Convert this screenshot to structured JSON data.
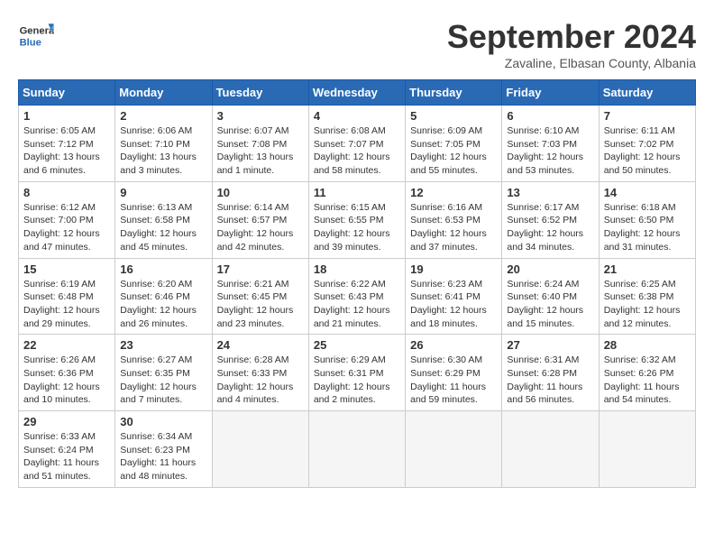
{
  "header": {
    "logo_text_general": "General",
    "logo_text_blue": "Blue",
    "month": "September 2024",
    "location": "Zavaline, Elbasan County, Albania"
  },
  "days_of_week": [
    "Sunday",
    "Monday",
    "Tuesday",
    "Wednesday",
    "Thursday",
    "Friday",
    "Saturday"
  ],
  "weeks": [
    [
      {
        "day": "1",
        "sunrise": "6:05 AM",
        "sunset": "7:12 PM",
        "daylight": "13 hours and 6 minutes."
      },
      {
        "day": "2",
        "sunrise": "6:06 AM",
        "sunset": "7:10 PM",
        "daylight": "13 hours and 3 minutes."
      },
      {
        "day": "3",
        "sunrise": "6:07 AM",
        "sunset": "7:08 PM",
        "daylight": "13 hours and 1 minute."
      },
      {
        "day": "4",
        "sunrise": "6:08 AM",
        "sunset": "7:07 PM",
        "daylight": "12 hours and 58 minutes."
      },
      {
        "day": "5",
        "sunrise": "6:09 AM",
        "sunset": "7:05 PM",
        "daylight": "12 hours and 55 minutes."
      },
      {
        "day": "6",
        "sunrise": "6:10 AM",
        "sunset": "7:03 PM",
        "daylight": "12 hours and 53 minutes."
      },
      {
        "day": "7",
        "sunrise": "6:11 AM",
        "sunset": "7:02 PM",
        "daylight": "12 hours and 50 minutes."
      }
    ],
    [
      {
        "day": "8",
        "sunrise": "6:12 AM",
        "sunset": "7:00 PM",
        "daylight": "12 hours and 47 minutes."
      },
      {
        "day": "9",
        "sunrise": "6:13 AM",
        "sunset": "6:58 PM",
        "daylight": "12 hours and 45 minutes."
      },
      {
        "day": "10",
        "sunrise": "6:14 AM",
        "sunset": "6:57 PM",
        "daylight": "12 hours and 42 minutes."
      },
      {
        "day": "11",
        "sunrise": "6:15 AM",
        "sunset": "6:55 PM",
        "daylight": "12 hours and 39 minutes."
      },
      {
        "day": "12",
        "sunrise": "6:16 AM",
        "sunset": "6:53 PM",
        "daylight": "12 hours and 37 minutes."
      },
      {
        "day": "13",
        "sunrise": "6:17 AM",
        "sunset": "6:52 PM",
        "daylight": "12 hours and 34 minutes."
      },
      {
        "day": "14",
        "sunrise": "6:18 AM",
        "sunset": "6:50 PM",
        "daylight": "12 hours and 31 minutes."
      }
    ],
    [
      {
        "day": "15",
        "sunrise": "6:19 AM",
        "sunset": "6:48 PM",
        "daylight": "12 hours and 29 minutes."
      },
      {
        "day": "16",
        "sunrise": "6:20 AM",
        "sunset": "6:46 PM",
        "daylight": "12 hours and 26 minutes."
      },
      {
        "day": "17",
        "sunrise": "6:21 AM",
        "sunset": "6:45 PM",
        "daylight": "12 hours and 23 minutes."
      },
      {
        "day": "18",
        "sunrise": "6:22 AM",
        "sunset": "6:43 PM",
        "daylight": "12 hours and 21 minutes."
      },
      {
        "day": "19",
        "sunrise": "6:23 AM",
        "sunset": "6:41 PM",
        "daylight": "12 hours and 18 minutes."
      },
      {
        "day": "20",
        "sunrise": "6:24 AM",
        "sunset": "6:40 PM",
        "daylight": "12 hours and 15 minutes."
      },
      {
        "day": "21",
        "sunrise": "6:25 AM",
        "sunset": "6:38 PM",
        "daylight": "12 hours and 12 minutes."
      }
    ],
    [
      {
        "day": "22",
        "sunrise": "6:26 AM",
        "sunset": "6:36 PM",
        "daylight": "12 hours and 10 minutes."
      },
      {
        "day": "23",
        "sunrise": "6:27 AM",
        "sunset": "6:35 PM",
        "daylight": "12 hours and 7 minutes."
      },
      {
        "day": "24",
        "sunrise": "6:28 AM",
        "sunset": "6:33 PM",
        "daylight": "12 hours and 4 minutes."
      },
      {
        "day": "25",
        "sunrise": "6:29 AM",
        "sunset": "6:31 PM",
        "daylight": "12 hours and 2 minutes."
      },
      {
        "day": "26",
        "sunrise": "6:30 AM",
        "sunset": "6:29 PM",
        "daylight": "11 hours and 59 minutes."
      },
      {
        "day": "27",
        "sunrise": "6:31 AM",
        "sunset": "6:28 PM",
        "daylight": "11 hours and 56 minutes."
      },
      {
        "day": "28",
        "sunrise": "6:32 AM",
        "sunset": "6:26 PM",
        "daylight": "11 hours and 54 minutes."
      }
    ],
    [
      {
        "day": "29",
        "sunrise": "6:33 AM",
        "sunset": "6:24 PM",
        "daylight": "11 hours and 51 minutes."
      },
      {
        "day": "30",
        "sunrise": "6:34 AM",
        "sunset": "6:23 PM",
        "daylight": "11 hours and 48 minutes."
      },
      null,
      null,
      null,
      null,
      null
    ]
  ]
}
